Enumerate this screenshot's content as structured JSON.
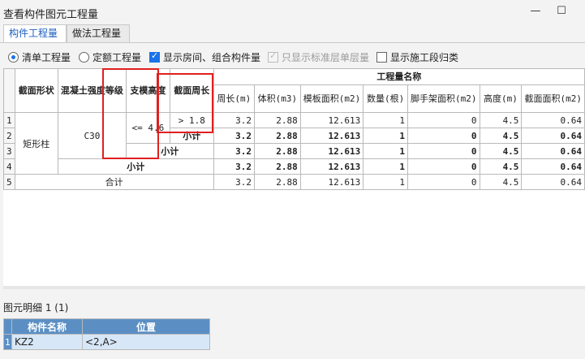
{
  "window": {
    "title": "查看构件图元工程量",
    "minimize_glyph": "—",
    "maximize_glyph": "☐",
    "close_glyph": "✕"
  },
  "tabs": [
    {
      "label": "构件工程量",
      "active": true
    },
    {
      "label": "做法工程量",
      "active": false
    }
  ],
  "options": {
    "radio_list": "清单工程量",
    "radio_quota": "定额工程量",
    "chk_show_room": "显示房间、组合构件量",
    "chk_only_std": "只显示标准层单层量",
    "chk_construction": "显示施工段归类"
  },
  "grid": {
    "headers": {
      "shape": "截面形状",
      "concrete": "混凝土强度等级",
      "support": "支模高度",
      "perimeter_group": "截面周长",
      "quantity_group": "工程量名称",
      "cols": [
        "周长(m)",
        "体积(m3)",
        "模板面积(m2)",
        "数量(根)",
        "脚手架面积(m2)",
        "高度(m)",
        "截面面积(m2)"
      ]
    },
    "row_numbers": [
      "1",
      "2",
      "3",
      "4",
      "5"
    ],
    "shape_value": "矩形柱",
    "concrete_value": "C30",
    "support_value": "<= 4.6",
    "perimeter_value": "> 1.8",
    "subtotal": "小计",
    "total": "合计",
    "rows": [
      [
        "3.2",
        "2.88",
        "12.613",
        "1",
        "0",
        "4.5",
        "0.64"
      ],
      [
        "3.2",
        "2.88",
        "12.613",
        "1",
        "0",
        "4.5",
        "0.64"
      ],
      [
        "3.2",
        "2.88",
        "12.613",
        "1",
        "0",
        "4.5",
        "0.64"
      ],
      [
        "3.2",
        "2.88",
        "12.613",
        "1",
        "0",
        "4.5",
        "0.64"
      ],
      [
        "3.2",
        "2.88",
        "12.613",
        "1",
        "0",
        "4.5",
        "0.64"
      ]
    ]
  },
  "detail": {
    "title": "图元明细",
    "count": "1 (1)",
    "headers": [
      "构件名称",
      "位置"
    ],
    "row_number": "1",
    "rows": [
      [
        "KZ2",
        "<2,A>"
      ]
    ]
  },
  "colors": {
    "accent": "#1a73e8",
    "highlight": "#e02020",
    "detail_header": "#5b8fc4"
  }
}
